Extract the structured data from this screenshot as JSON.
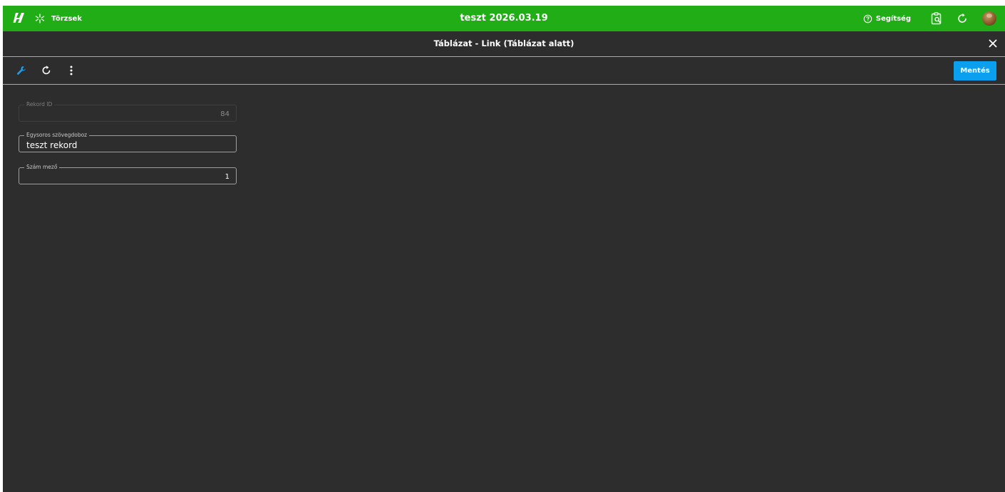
{
  "topbar": {
    "brand_color": "#20ad16",
    "nav_label": "Törzsek",
    "nav_icon": "asterisk-icon",
    "title": "teszt 2026.03.19",
    "help_label": "Segítség",
    "help_icon": "help-circle-icon",
    "icons": [
      "clipboard-search-icon",
      "refresh-icon",
      "user-avatar"
    ]
  },
  "dialog": {
    "title": "Táblázat - Link (Táblázat alatt)",
    "close_icon": "close-icon"
  },
  "toolbar": {
    "tools": [
      "wrench-icon",
      "refresh-icon",
      "more-vertical-icon"
    ],
    "save_label": "Mentés",
    "accent_color": "#0b9ff0"
  },
  "form": {
    "record_id": {
      "label": "Rekord ID",
      "value": "84"
    },
    "text_field": {
      "label": "Egysoros szövegdoboz",
      "value": "teszt rekord"
    },
    "number_field": {
      "label": "Szám mező",
      "value": "1"
    }
  }
}
